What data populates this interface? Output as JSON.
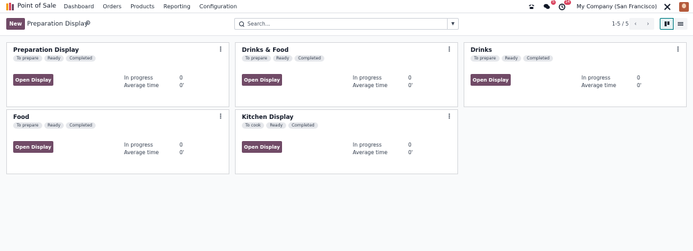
{
  "navbar": {
    "app_name": "Point of Sale",
    "menu": [
      "Dashboard",
      "Orders",
      "Products",
      "Reporting",
      "Configuration"
    ],
    "chat_badge": "5",
    "activity_badge": "14",
    "company": "My Company (San Francisco)"
  },
  "control": {
    "new_label": "New",
    "breadcrumb": "Preparation Display",
    "search_placeholder": "Search...",
    "pager": "1-5 / 5"
  },
  "cards": [
    {
      "title": "Preparation Display",
      "tags": [
        "To prepare",
        "Ready",
        "Completed"
      ],
      "button": "Open Display",
      "in_progress_label": "In progress",
      "in_progress": "0",
      "avg_label": "Average time",
      "avg": "0'"
    },
    {
      "title": "Drinks & Food",
      "tags": [
        "To prepare",
        "Ready",
        "Completed"
      ],
      "button": "Open Display",
      "in_progress_label": "In progress",
      "in_progress": "0",
      "avg_label": "Average time",
      "avg": "0'"
    },
    {
      "title": "Drinks",
      "tags": [
        "To prepare",
        "Ready",
        "Completed"
      ],
      "button": "Open Display",
      "in_progress_label": "In progress",
      "in_progress": "0",
      "avg_label": "Average time",
      "avg": "0'"
    },
    {
      "title": "Food",
      "tags": [
        "To prepare",
        "Ready",
        "Completed"
      ],
      "button": "Open Display",
      "in_progress_label": "In progress",
      "in_progress": "0",
      "avg_label": "Average time",
      "avg": "0'"
    },
    {
      "title": "Kitchen Display",
      "tags": [
        "To cook",
        "Ready",
        "Completed"
      ],
      "button": "Open Display",
      "in_progress_label": "In progress",
      "in_progress": "0",
      "avg_label": "Average time",
      "avg": "0'"
    }
  ],
  "colors": {
    "brand": "#714b67",
    "accent": "#017e84",
    "badge": "#d9455f"
  },
  "icons": [
    "app-logo-icon",
    "phone-icon",
    "chat-icon",
    "activity-icon",
    "settings-tools-icon",
    "gear-icon",
    "search-icon",
    "caret-down-icon",
    "chevron-left-icon",
    "chevron-right-icon",
    "kanban-view-icon",
    "list-view-icon",
    "kebab-menu-icon"
  ]
}
